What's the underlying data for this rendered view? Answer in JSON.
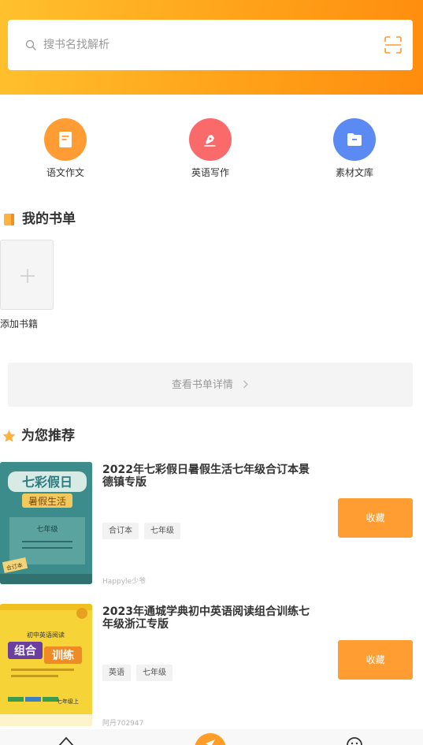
{
  "search": {
    "placeholder": "搜书名找解析"
  },
  "quick_actions": [
    {
      "label": "语文作文",
      "icon": "document-icon",
      "color": "#ff9c33"
    },
    {
      "label": "英语写作",
      "icon": "pen-icon",
      "color": "#fa6a6a"
    },
    {
      "label": "素材文库",
      "icon": "folder-icon",
      "color": "#5b8af2"
    }
  ],
  "my_books": {
    "title": "我的书单",
    "add_label": "添加书籍",
    "detail_label": "查看书单详情"
  },
  "recommend": {
    "title": "为您推荐",
    "collect_label": "收藏",
    "items": [
      {
        "title": "2022年七彩假日暑假生活七年级合订本景德镇专版",
        "tags": [
          "合订本",
          "七年级"
        ],
        "author": "Happyle少爷",
        "cover": {
          "brand": "七彩假日",
          "subtitle": "暑假生活",
          "grade": "七年级",
          "badge": "合订本"
        }
      },
      {
        "title": "2023年通城学典初中英语阅读组合训练七年级浙江专版",
        "tags": [
          "英语",
          "七年级"
        ],
        "author": "阿丹702947",
        "cover": {
          "top": "初中英语阅读",
          "word1": "组合",
          "word2": "训练",
          "grade": "七年级上"
        }
      }
    ]
  },
  "colors": {
    "accent": "#ff9d33",
    "header_start": "#ffc12e",
    "header_end": "#ff8c0d"
  }
}
